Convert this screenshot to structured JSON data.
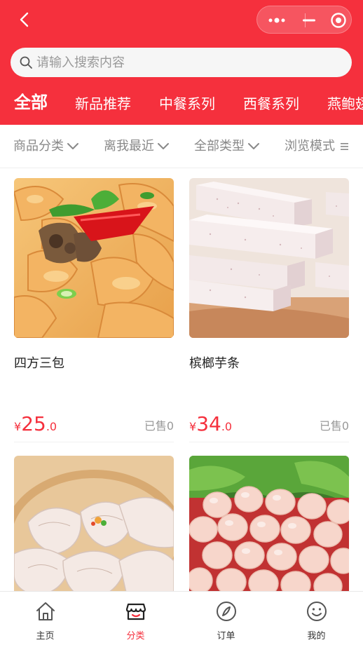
{
  "search": {
    "placeholder": "请输入搜索内容"
  },
  "tabs": [
    "全部",
    "新品推荐",
    "中餐系列",
    "西餐系列",
    "燕鲍翅"
  ],
  "filters": [
    "商品分类",
    "离我最近",
    "全部类型",
    "浏览模式"
  ],
  "products": [
    {
      "name": "四方三包",
      "price_symbol": "¥",
      "price_int": "25",
      "price_dec": ".0",
      "sold": "已售0"
    },
    {
      "name": "槟榔芋条",
      "price_symbol": "¥",
      "price_int": "34",
      "price_dec": ".0",
      "sold": "已售0"
    }
  ],
  "nav": [
    {
      "label": "主页",
      "icon": "home-icon"
    },
    {
      "label": "分类",
      "icon": "store-icon",
      "active": true
    },
    {
      "label": "订单",
      "icon": "compass-icon"
    },
    {
      "label": "我的",
      "icon": "smiley-icon"
    }
  ],
  "colors": {
    "brand": "#f5303d",
    "price": "#f5303d"
  }
}
